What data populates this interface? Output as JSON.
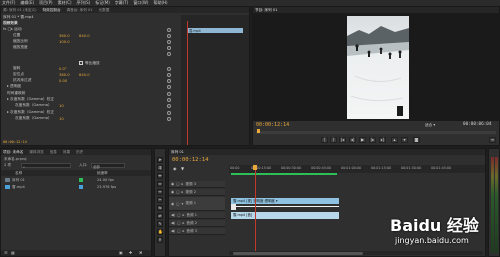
{
  "menu": [
    "文件(F)",
    "编辑(E)",
    "项目(P)",
    "素材(C)",
    "序列(S)",
    "标记(M)",
    "字幕(T)",
    "窗口(W)",
    "帮助(H)"
  ],
  "source_panel": {
    "tabs": [
      "源: 序列 01 (未定义)",
      "特效控制台",
      "调音台: 序列 01",
      "元数据"
    ],
    "sequence_label": "序列 01 * 雪.mp4",
    "clip_label": "雪.mp4",
    "video_effects_label": "视频效果",
    "rows": [
      {
        "label": "fx  □▸ 运动",
        "value1": "",
        "value2": ""
      },
      {
        "label": "位置",
        "value1": "360.0",
        "value2": "640.0"
      },
      {
        "label": "缩放比例",
        "value1": "100.0",
        "value2": ""
      },
      {
        "label": "缩放宽度",
        "value1": "",
        "value2": ""
      },
      {
        "label": "",
        "value1": "",
        "value2": ""
      },
      {
        "label": "旋转",
        "value1": "0.0°",
        "value2": ""
      },
      {
        "label": "定位点",
        "value1": "360.0",
        "value2": "640.0"
      },
      {
        "label": "抗闪烁过滤",
        "value1": "0.00",
        "value2": ""
      },
      {
        "label": "▸ 透明度",
        "value1": "",
        "value2": ""
      },
      {
        "label": "时间重映射",
        "value1": "",
        "value2": ""
      },
      {
        "label": "▸ 灰度系数（Gamma）校正",
        "value1": "",
        "value2": ""
      },
      {
        "label": "灰度系数（Gamma）",
        "value1": "10",
        "value2": ""
      },
      {
        "label": "▸ 灰度系数（Gamma）校正",
        "value1": "",
        "value2": ""
      },
      {
        "label": "灰度系数（Gamma）",
        "value1": "10",
        "value2": ""
      }
    ],
    "uniform_scale_label": "等比缩放",
    "timecode": "00:00:12:14"
  },
  "program_panel": {
    "tab": "节目: 序列 01",
    "timecode_left": "00:00:12:14",
    "fit_label": "适合",
    "timecode_right": "00:00:06:04"
  },
  "project_panel": {
    "tabs": [
      "项目: 未命名",
      "媒体浏览",
      "信息",
      "效果",
      "历史"
    ],
    "project_name": "未命名.prproj",
    "items_count": "2 项",
    "entry_label": "入口:",
    "entry_value": "全部",
    "col_name": "名称",
    "col_fps": "帧速率",
    "items": [
      {
        "name": "序列 01",
        "fps": "24.00 fps",
        "color": "#2fbf5a"
      },
      {
        "name": "雪.mp4",
        "fps": "23.976 fps",
        "color": "#4aa0d8"
      }
    ]
  },
  "timeline_panel": {
    "tab": "序列 01",
    "timecode": "00:00:12:14",
    "ruler": [
      "00:00",
      "00:00:15:00",
      "00:00:30:00",
      "00:00:45:00",
      "00:01:00:00",
      "00:01:15:00",
      "00:01:30:00",
      "00:01:45:00"
    ],
    "tracks": [
      {
        "name": "视频 3",
        "kind": "video"
      },
      {
        "name": "视频 2",
        "kind": "video"
      },
      {
        "name": "视频 1",
        "kind": "video"
      },
      {
        "name": "音频 1",
        "kind": "audio"
      },
      {
        "name": "音频 2",
        "kind": "audio"
      },
      {
        "name": "音频 3",
        "kind": "audio"
      }
    ],
    "video_clip_label": "雪.mp4 [视]  透明度:透明度 ▾",
    "audio_clip_label": "雪.mp4 [音]"
  },
  "watermark": {
    "brand": "Baidu 经验",
    "url": "jingyan.baidu.com"
  },
  "colors": {
    "accent": "#e8a83a",
    "playhead": "#c0392b",
    "video_clip": "#8fc2e0",
    "audio_clip": "#b7d7ea",
    "green_bar": "#2fbf5a"
  }
}
